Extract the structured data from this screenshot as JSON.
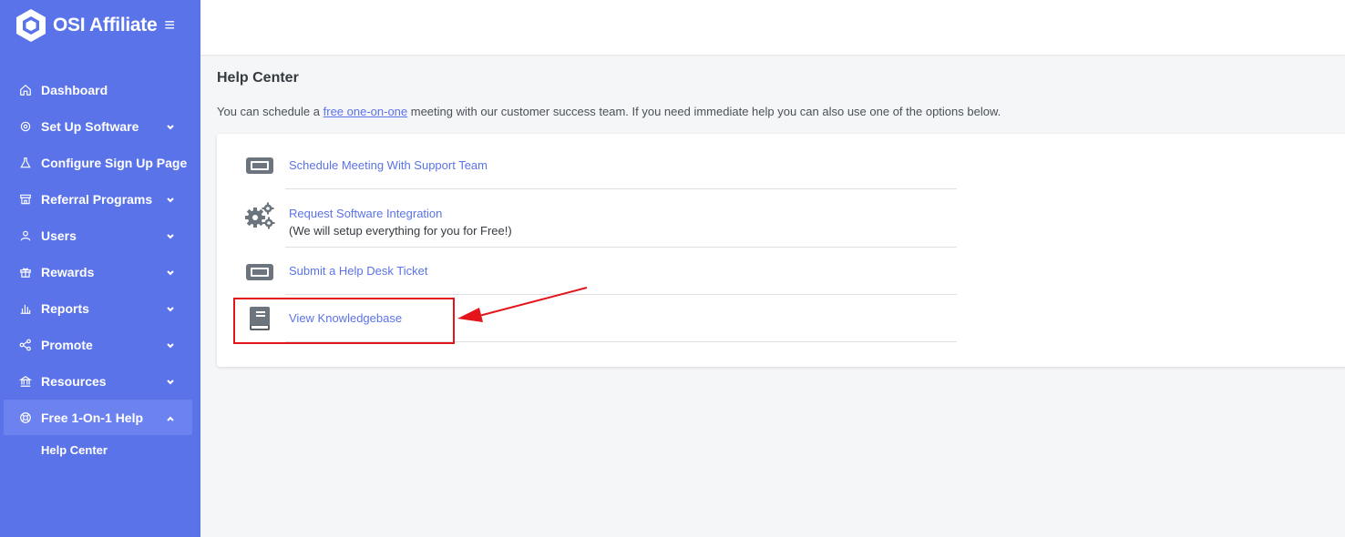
{
  "brand": {
    "name": "OSI Affiliate"
  },
  "sidebar": {
    "items": [
      {
        "label": "Dashboard",
        "icon": "home-icon",
        "has_chevron": false
      },
      {
        "label": "Set Up Software",
        "icon": "gear-icon",
        "has_chevron": true
      },
      {
        "label": "Configure Sign Up Page",
        "icon": "flask-icon",
        "has_chevron": false
      },
      {
        "label": "Referral Programs",
        "icon": "store-icon",
        "has_chevron": true
      },
      {
        "label": "Users",
        "icon": "user-icon",
        "has_chevron": true
      },
      {
        "label": "Rewards",
        "icon": "gift-icon",
        "has_chevron": true
      },
      {
        "label": "Reports",
        "icon": "bar-chart-icon",
        "has_chevron": true
      },
      {
        "label": "Promote",
        "icon": "share-icon",
        "has_chevron": true
      },
      {
        "label": "Resources",
        "icon": "bank-icon",
        "has_chevron": true
      },
      {
        "label": "Free 1-On-1 Help",
        "icon": "lifebuoy-icon",
        "has_chevron": true,
        "expanded": true
      }
    ],
    "sub_items": [
      {
        "label": "Help Center"
      }
    ]
  },
  "main": {
    "title": "Help Center",
    "intro_before": "You can schedule a ",
    "intro_link": "free one-on-one",
    "intro_after": " meeting with our customer success team. If you need immediate help you can also use one of the options below.",
    "options": [
      {
        "label": "Schedule Meeting With Support Team",
        "icon": "ticket-icon"
      },
      {
        "label": "Request Software Integration",
        "sub": "(We will setup everything for you for Free!)",
        "icon": "cogs-icon"
      },
      {
        "label": "Submit a Help Desk Ticket",
        "icon": "ticket-icon"
      },
      {
        "label": "View Knowledgebase",
        "icon": "book-icon"
      }
    ]
  },
  "colors": {
    "sidebar": "#5b73e8",
    "accent": "#5b73e8",
    "annotation": "#e3141a"
  }
}
